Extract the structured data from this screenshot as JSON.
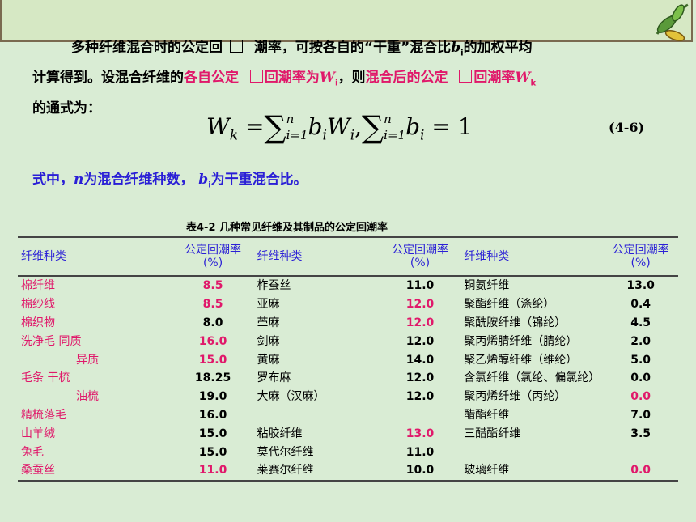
{
  "paragraph": {
    "line1_pre": "多种纤维混合时的公定回",
    "line1_mid": "潮率，可按各自的“干重”混合比",
    "line1_var": "b",
    "line1_sub": "i",
    "line1_post": "的加权平均",
    "line2_pre": "计算得到。设混合纤维的",
    "line2_red1": "各自公定",
    "line2_red1b": "回潮率为",
    "line2_var1": "W",
    "line2_sub1": "i",
    "line2_mid": "，则",
    "line2_red2": "混合后的公定",
    "line2_red2b": "回潮率",
    "line2_var2": "W",
    "line2_sub2": "k",
    "line3": "的通式为："
  },
  "formula": {
    "lhs": "W",
    "lhs_sub": "k",
    "eq": "=",
    "sum_top": "n",
    "sum_bottom": "i=1",
    "term1_b": "b",
    "term1_bsub": "i",
    "term1_W": "W",
    "term1_Wsub": "i",
    "comma": ",",
    "term2_b": "b",
    "term2_bsub": "i",
    "rhs": "= 1",
    "eq_number": "(4-6)"
  },
  "note": {
    "pre": "式中，",
    "n": "n",
    "mid": "为混合纤维种数，",
    "b": "b",
    "bsub": "i",
    "post": "为干重混合比。"
  },
  "table": {
    "caption": "表4-2  几种常见纤维及其制品的公定回潮率",
    "headers": [
      "纤维种类",
      "公定回潮率(%)",
      "纤维种类",
      "公定回潮率(%)",
      "纤维种类",
      "公定回潮率(%)"
    ],
    "rows": [
      {
        "n1": "棉纤维",
        "v1": "8.5",
        "p1": true,
        "n2": "柞蚕丝",
        "v2": "11.0",
        "p2": false,
        "n3": "铜氨纤维",
        "v3": "13.0",
        "p3": false
      },
      {
        "n1": "棉纱线",
        "v1": "8.5",
        "p1": true,
        "n2": "亚麻",
        "v2": "12.0",
        "p2": true,
        "n3": "聚酯纤维（涤纶）",
        "v3": "0.4",
        "p3": false
      },
      {
        "n1": "棉织物",
        "v1": "8.0",
        "p1": false,
        "n2": "苎麻",
        "v2": "12.0",
        "p2": true,
        "n3": "聚酰胺纤维（锦纶）",
        "v3": "4.5",
        "p3": false
      },
      {
        "n1": "洗净毛  同质",
        "v1": "16.0",
        "p1": true,
        "n2": "剑麻",
        "v2": "12.0",
        "p2": false,
        "n3": "聚丙烯腈纤维（腈纶）",
        "v3": "2.0",
        "p3": false
      },
      {
        "n1": "异质",
        "indent": true,
        "v1": "15.0",
        "p1": true,
        "n2": "黄麻",
        "v2": "14.0",
        "p2": false,
        "n3": "聚乙烯醇纤维（维纶）",
        "v3": "5.0",
        "p3": false
      },
      {
        "n1": "毛条      干梳",
        "v1": "18.25",
        "p1": false,
        "n2": "罗布麻",
        "v2": "12.0",
        "p2": false,
        "n3": "含氯纤维（氯纶、偏氯纶）",
        "v3": "0.0",
        "p3": false
      },
      {
        "n1": "油梳",
        "indent": true,
        "v1": "19.0",
        "p1": false,
        "n2": "大麻（汉麻）",
        "v2": "12.0",
        "p2": false,
        "n3": "聚丙烯纤维（丙纶）",
        "v3": "0.0",
        "p3": true
      },
      {
        "n1": "精梳落毛",
        "v1": "16.0",
        "p1": false,
        "n2": "",
        "v2": "",
        "p2": false,
        "n3": "醋酯纤维",
        "v3": "7.0",
        "p3": false
      },
      {
        "n1": "山羊绒",
        "v1": "15.0",
        "p1": false,
        "n2": "粘胶纤维",
        "v2": "13.0",
        "p2": true,
        "n3": "三醋酯纤维",
        "v3": "3.5",
        "p3": false
      },
      {
        "n1": "兔毛",
        "v1": "15.0",
        "p1": false,
        "n2": "莫代尔纤维",
        "v2": "11.0",
        "p2": false,
        "n3": "",
        "v3": "",
        "p3": false
      },
      {
        "n1": "桑蚕丝",
        "v1": "11.0",
        "p1": true,
        "n2": "莱赛尔纤维",
        "v2": "10.0",
        "p2": false,
        "n3": "玻璃纤维",
        "v3": "0.0",
        "p3": true
      }
    ]
  }
}
